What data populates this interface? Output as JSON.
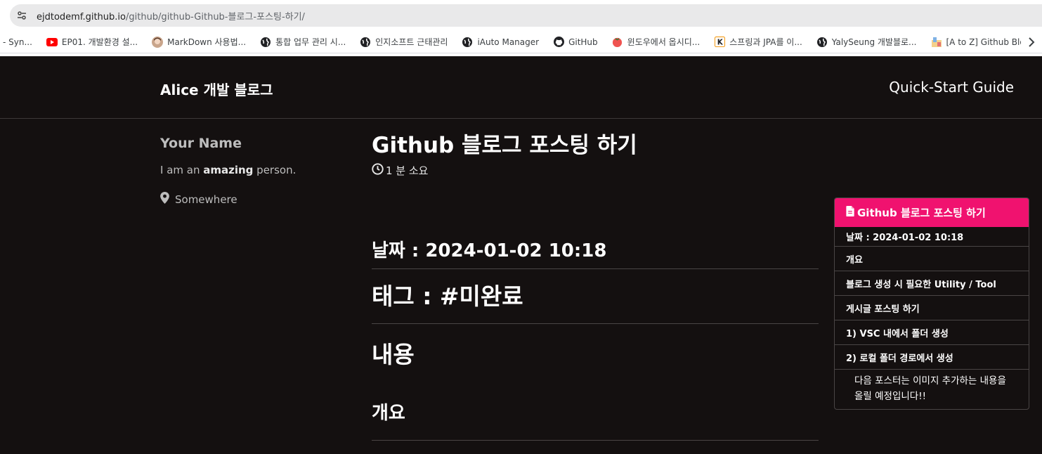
{
  "browser": {
    "url_host": "ejdtodemf.github.io",
    "url_path": "/github/github-Github-블로그-포스팅-하기/",
    "bookmarks": [
      {
        "label": "- Syn...",
        "icon": "none"
      },
      {
        "label": "EP01. 개발환경 설...",
        "icon": "youtube-icon"
      },
      {
        "label": "MarkDown 사용법...",
        "icon": "avatar-icon"
      },
      {
        "label": "통합 업무 관리 시...",
        "icon": "globe-icon"
      },
      {
        "label": "인지소프트 근태관리",
        "icon": "globe-icon"
      },
      {
        "label": "iAuto Manager",
        "icon": "globe-icon"
      },
      {
        "label": "GitHub",
        "icon": "github-icon"
      },
      {
        "label": "윈도우에서 옵시디...",
        "icon": "tomato-icon"
      },
      {
        "label": "스프링과 JPA를 이...",
        "icon": "k-icon"
      },
      {
        "label": "YalySeung 개발블로...",
        "icon": "globe-icon"
      },
      {
        "label": "[A to Z] Github Blo...",
        "icon": "blog-icon"
      }
    ]
  },
  "site": {
    "title": "Alice 개발 블로그",
    "nav_link": "Quick-Start Guide"
  },
  "author": {
    "name": "Your Name",
    "bio_pre": "I am an ",
    "bio_bold": "amazing",
    "bio_post": " person.",
    "location": "Somewhere"
  },
  "post": {
    "title": "Github 블로그 포스팅 하기",
    "read_time": "1 분 소요",
    "heading_date": "날짜 : 2024-01-02 10:18",
    "heading_tag": "태그 : #미완료",
    "heading_content": "내용",
    "heading_overview": "개요"
  },
  "toc": {
    "title": "Github 블로그 포스팅 하기",
    "items": [
      "날짜 : 2024-01-02 10:18",
      "개요",
      "블로그 생성 시 필요한 Utility / Tool",
      "게시글 포스팅 하기",
      "1) VSC 내에서 폴더 생성",
      "2) 로컬 폴더 경로에서 생성"
    ],
    "sub_item": "다음 포스터는 이미지 추가하는 내용을 올릴 예정입니다!!"
  },
  "colors": {
    "page_background": "#141010",
    "toc_header": "#f0126f"
  }
}
